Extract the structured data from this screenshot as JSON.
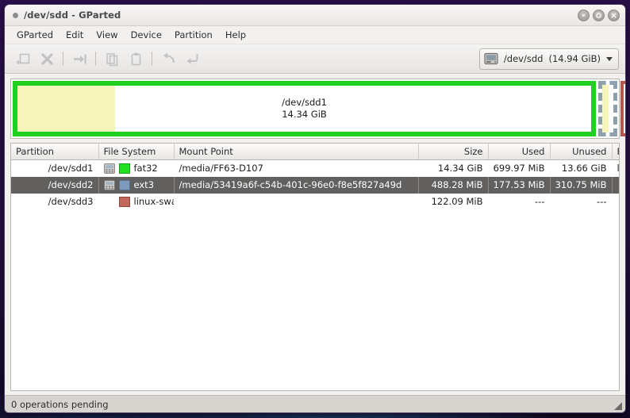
{
  "window": {
    "title": "/dev/sdd - GParted",
    "buttons": [
      {
        "name": "minimize",
        "glyph": "minimize-icon"
      },
      {
        "name": "maximize",
        "glyph": "maximize-icon"
      },
      {
        "name": "close",
        "glyph": "close-icon"
      }
    ]
  },
  "menubar": {
    "items": [
      {
        "label": "GParted"
      },
      {
        "label": "Edit"
      },
      {
        "label": "View"
      },
      {
        "label": "Device"
      },
      {
        "label": "Partition"
      },
      {
        "label": "Help"
      }
    ]
  },
  "toolbar": {
    "buttons": [
      {
        "name": "new-partition-button",
        "icon": "new-partition-icon",
        "enabled": false
      },
      {
        "name": "delete-partition-button",
        "icon": "delete-icon",
        "enabled": false
      },
      {
        "name": "resize-move-button",
        "icon": "resize-move-icon",
        "enabled": false
      },
      {
        "name": "copy-button",
        "icon": "copy-icon",
        "enabled": false
      },
      {
        "name": "paste-button",
        "icon": "paste-icon",
        "enabled": false
      },
      {
        "name": "undo-button",
        "icon": "undo-icon",
        "enabled": false
      },
      {
        "name": "apply-button",
        "icon": "apply-icon",
        "enabled": false
      }
    ],
    "device_selector": {
      "icon": "hard-drive-icon",
      "device": "/dev/sdd",
      "size": "(14.94 GiB)",
      "caret": "chevron-down-icon"
    }
  },
  "graphic": {
    "partitions": [
      {
        "name": "/dev/sdd1",
        "size": "14.34 GiB",
        "border_color": "#20d020",
        "used_color": "#f5f5bc",
        "used_fraction": 0.17,
        "selected": true
      },
      {
        "name": "/dev/sdd2",
        "border_color": "#8fa0ad",
        "used_color": "#f5f5bc",
        "used_fraction": 0.6,
        "selected": false
      },
      {
        "name": "/dev/sdd3",
        "border_color": "#b5564b",
        "used_color": "#ffffff",
        "used_fraction": 0,
        "selected": false
      }
    ]
  },
  "table": {
    "headers": [
      {
        "label": "Partition"
      },
      {
        "label": "File System"
      },
      {
        "label": "Mount Point"
      },
      {
        "label": "Size"
      },
      {
        "label": "Used"
      },
      {
        "label": "Unused"
      },
      {
        "label": "Flags"
      }
    ],
    "rows": [
      {
        "partition": "/dev/sdd1",
        "mounted_icon": "mounted-device-icon",
        "filesystem": "fat32",
        "fs_color": "#20e020",
        "mount_point": "/media/FF63-D107",
        "size": "14.34 GiB",
        "used": "699.97 MiB",
        "unused": "13.66 GiB",
        "flags": "lba",
        "selected": false
      },
      {
        "partition": "/dev/sdd2",
        "mounted_icon": "mounted-device-icon",
        "filesystem": "ext3",
        "fs_color": "#7e9bbd",
        "mount_point": "/media/53419a6f-c54b-401c-96e0-f8e5f827a49d",
        "size": "488.28 MiB",
        "used": "177.53 MiB",
        "unused": "310.75 MiB",
        "flags": "",
        "selected": true
      },
      {
        "partition": "/dev/sdd3",
        "mounted_icon": "",
        "filesystem": "linux-swap",
        "fs_color": "#c4675b",
        "mount_point": "",
        "size": "122.09 MiB",
        "used": "---",
        "unused": "---",
        "flags": "",
        "selected": false
      }
    ]
  },
  "statusbar": {
    "text": "0 operations pending",
    "grip": "resize-grip-icon"
  }
}
